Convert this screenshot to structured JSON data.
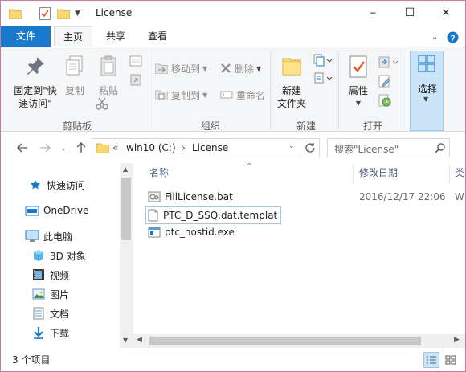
{
  "window": {
    "title": "License",
    "minimize_glyph": "─",
    "maximize_glyph": "☐",
    "close_glyph": "✕"
  },
  "ribbon_tabs": {
    "file": "文件",
    "home": "主页",
    "share": "共享",
    "view": "查看"
  },
  "ribbon": {
    "clipboard": {
      "label": "剪贴板",
      "pin": "固定到\"快速访问\"",
      "copy": "复制",
      "paste": "粘贴"
    },
    "organize": {
      "label": "组织",
      "move_to": "移动到",
      "copy_to": "复制到",
      "delete": "删除",
      "rename": "重命名"
    },
    "new": {
      "label": "新建",
      "new_folder": "新建\n文件夹"
    },
    "open": {
      "label": "打开",
      "properties": "属性"
    },
    "select": {
      "label": "选择"
    }
  },
  "address": {
    "prefix": "«",
    "segment_drive": "win10 (C:)",
    "separator": "›",
    "segment_folder": "License",
    "search_placeholder": "搜索\"License\""
  },
  "nav_pane": {
    "items": [
      {
        "label": "快速访问",
        "icon": "star-icon"
      },
      {
        "label": "OneDrive",
        "icon": "onedrive-icon"
      },
      {
        "label": "此电脑",
        "icon": "computer-icon"
      },
      {
        "label": "3D 对象",
        "icon": "cube-icon"
      },
      {
        "label": "视频",
        "icon": "video-icon"
      },
      {
        "label": "图片",
        "icon": "picture-icon"
      },
      {
        "label": "文档",
        "icon": "document-icon"
      },
      {
        "label": "下载",
        "icon": "download-icon"
      }
    ]
  },
  "columns": {
    "name": "名称",
    "date": "修改日期",
    "type": "类"
  },
  "files": [
    {
      "name": "FillLicense.bat",
      "date": "2016/12/17 22:06",
      "type": "W",
      "icon": "batch-file-icon"
    },
    {
      "name": "PTC_D_SSQ.dat.templat",
      "date": "",
      "type": "",
      "icon": "blank-file-icon"
    },
    {
      "name": "ptc_hostid.exe",
      "date": "",
      "type": "",
      "icon": "exe-file-icon"
    }
  ],
  "status": {
    "item_count": "3 个项目"
  },
  "colors": {
    "accent": "#1979ca",
    "window_border": "#c87aa0",
    "selection": "#cce4f7"
  }
}
